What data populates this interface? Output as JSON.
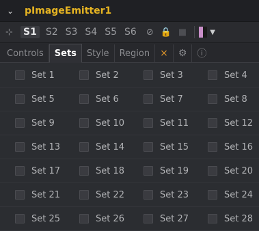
{
  "header": {
    "title": "pImageEmitter1"
  },
  "toolbar": {
    "slots": [
      "S1",
      "S2",
      "S3",
      "S4",
      "S5",
      "S6"
    ],
    "active_slot": "S1"
  },
  "tabs": [
    {
      "label": "Controls"
    },
    {
      "label": "Sets"
    },
    {
      "label": "Style"
    },
    {
      "label": "Region"
    }
  ],
  "sets": [
    "Set 1",
    "Set 2",
    "Set 3",
    "Set 4",
    "Set 5",
    "Set 6",
    "Set 7",
    "Set 8",
    "Set 9",
    "Set 10",
    "Set 11",
    "Set 12",
    "Set 13",
    "Set 14",
    "Set 15",
    "Set 16",
    "Set 17",
    "Set 18",
    "Set 19",
    "Set 20",
    "Set 21",
    "Set 22",
    "Set 23",
    "Set 24",
    "Set 25",
    "Set 26",
    "Set 27",
    "Set 28"
  ],
  "colors": {
    "title": "#e6b422",
    "swatch_left": "#c98fc9",
    "swatch_right": "#1a1a1a"
  }
}
